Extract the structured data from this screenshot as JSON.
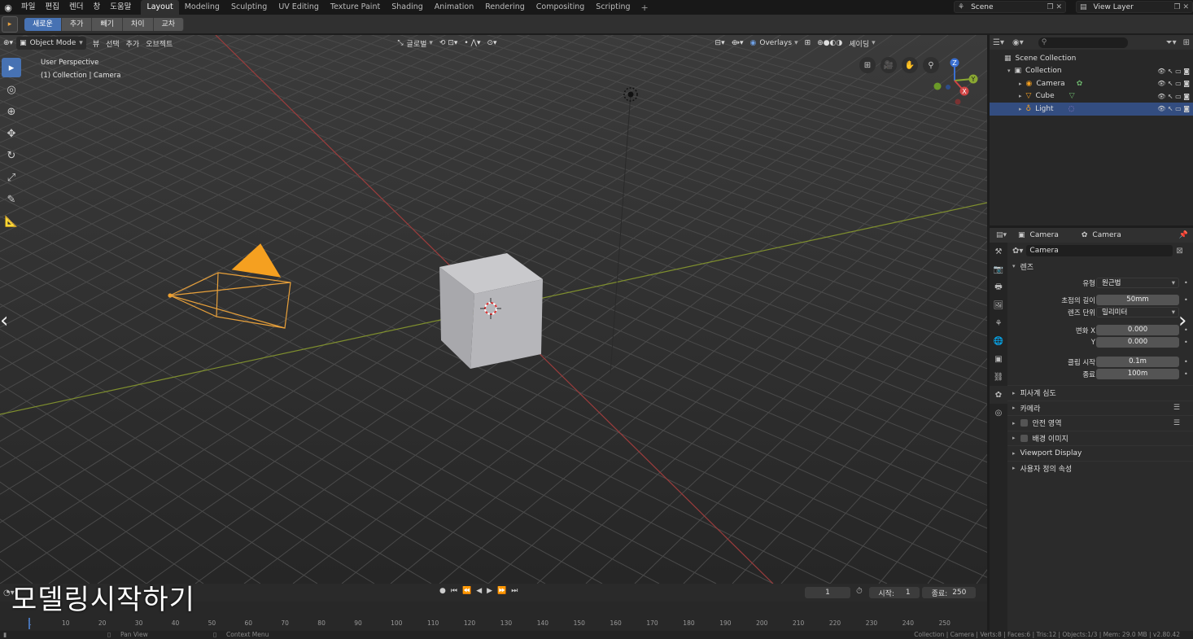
{
  "menu": [
    "파일",
    "편집",
    "렌더",
    "창",
    "도움말"
  ],
  "workspaces": [
    "Layout",
    "Modeling",
    "Sculpting",
    "UV Editing",
    "Texture Paint",
    "Shading",
    "Animation",
    "Rendering",
    "Compositing",
    "Scripting"
  ],
  "scene": {
    "label": "Scene",
    "view_layer": "View Layer"
  },
  "header2": {
    "modes": [
      "새로운",
      "추가",
      "빼기",
      "차이",
      "교차"
    ]
  },
  "viewport": {
    "mode": "Object Mode",
    "menus": [
      "뷰",
      "선택",
      "추가",
      "오브젝트"
    ],
    "transform": "글로벌",
    "overlays": "Overlays",
    "shading": "셰이딩",
    "perspective": "User Perspective",
    "collection_label": "(1) Collection | Camera",
    "gizmo": {
      "x": "X",
      "y": "Y",
      "z": "Z"
    }
  },
  "timeline": {
    "current_frame": "1",
    "start_label": "시작:",
    "start": "1",
    "end_label": "종료:",
    "end": "250",
    "ticks": [
      "1",
      "10",
      "20",
      "30",
      "40",
      "50",
      "60",
      "70",
      "80",
      "90",
      "100",
      "110",
      "120",
      "130",
      "140",
      "150",
      "160",
      "170",
      "180",
      "190",
      "200",
      "210",
      "220",
      "230",
      "240",
      "250"
    ]
  },
  "status": {
    "pan": "Pan View",
    "context": "Context Menu",
    "stats": "Collection | Camera | Verts:8 | Faces:6 | Tris:12 | Objects:1/3 | Mem: 29.0 MB | v2.80.42"
  },
  "subtitle": "모델링시작하기",
  "outliner": {
    "scene_collection": "Scene Collection",
    "collection": "Collection",
    "items": [
      "Camera",
      "Cube",
      "Light"
    ]
  },
  "properties": {
    "header_object": "Camera",
    "header_data": "Camera",
    "datablock": "Camera",
    "lens_panel": "렌즈",
    "rows": {
      "type_label": "유형",
      "type_value": "원근법",
      "focal_label": "초점의 길이",
      "focal_value": "50mm",
      "unit_label": "렌즈 단위",
      "unit_value": "밀리미터",
      "shiftx_label": "변화 X",
      "shiftx_value": "0.000",
      "shifty_label": "Y",
      "shifty_value": "0.000",
      "clipstart_label": "클립 시작",
      "clipstart_value": "0.1m",
      "clipend_label": "종료",
      "clipend_value": "100m"
    },
    "subpanels": [
      "피사계 심도",
      "카메라",
      "안전 영역",
      "배경 이미지",
      "Viewport Display",
      "사용자 정의 속성"
    ]
  },
  "colors": {
    "accent": "#4772b3",
    "selected_row": "#334d80",
    "orange": "#f5a020"
  }
}
